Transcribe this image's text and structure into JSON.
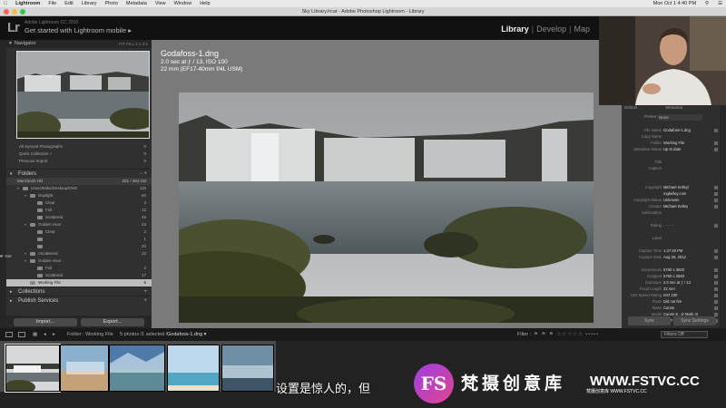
{
  "menubar": {
    "items": [
      "Lightroom",
      "File",
      "Edit",
      "Library",
      "Photo",
      "Metadata",
      "View",
      "Window",
      "Help"
    ],
    "clock": "Mon Oct 1  4:40 PM"
  },
  "window": {
    "title": "Sky Library.lrcat - Adobe Photoshop Lightroom - Library"
  },
  "identity": {
    "small": "Adobe Lightroom CC 2015",
    "big": "Get started with Lightroom mobile  ▸",
    "modules": [
      "Library",
      "Develop",
      "Map"
    ],
    "active_module": "Library"
  },
  "navigator": {
    "title": "Navigator",
    "zoom": "FIT  FILL  1:1  3:1"
  },
  "catalog": {
    "rows": [
      {
        "label": "All Synced Photographs",
        "count": "0"
      },
      {
        "label": "Quick Collection +",
        "count": "0"
      },
      {
        "label": "Previous Import",
        "count": "0"
      }
    ]
  },
  "folders": {
    "title": "Folders",
    "volume": {
      "label": "Macintosh HD",
      "count": "201 / 494 GB"
    },
    "items": [
      {
        "label": "Users/Mike/Desktop/DNG",
        "count": "119",
        "indent": 0,
        "arrow": "▾"
      },
      {
        "label": "Daylight",
        "count": "60",
        "indent": 1,
        "arrow": "▾"
      },
      {
        "label": "Clear",
        "count": "3",
        "indent": 2,
        "arrow": ""
      },
      {
        "label": "Full",
        "count": "12",
        "indent": 2,
        "arrow": ""
      },
      {
        "label": "Scattered",
        "count": "45",
        "indent": 2,
        "arrow": ""
      },
      {
        "label": "Golden Hour",
        "count": "23",
        "indent": 1,
        "arrow": "▾"
      },
      {
        "label": "Clear",
        "count": "2",
        "indent": 2,
        "arrow": ""
      },
      {
        "label": "",
        "count": "1",
        "indent": 2,
        "arrow": ""
      },
      {
        "label": "",
        "count": "20",
        "indent": 2,
        "arrow": ""
      },
      {
        "label": "cScattered",
        "count": "22",
        "indent": 1,
        "arrow": "▾"
      },
      {
        "label": "Golden Hour",
        "count": "",
        "indent": 1,
        "arrow": "▾"
      },
      {
        "label": "Full",
        "count": "2",
        "indent": 2,
        "arrow": ""
      },
      {
        "label": "Scattered",
        "count": "17",
        "indent": 2,
        "arrow": ""
      },
      {
        "label": "Working File",
        "count": "5",
        "indent": 1,
        "arrow": "",
        "selected": true
      }
    ],
    "side_hint": "Get"
  },
  "sections": {
    "collections": "Collections",
    "publish": "Publish Services"
  },
  "buttons": {
    "import": "Import...",
    "export": "Export...",
    "sync": "Sync",
    "sync_settings": "Sync Settings"
  },
  "loupe": {
    "filename": "Godafoss-1.dng",
    "line2": "2.0 sec at ƒ / 13, ISO 100",
    "line3": "22 mm (EF17-40mm f/4L USM)"
  },
  "metadata": {
    "header": "Default",
    "header2": "Metadata",
    "preset_label": "Preset",
    "preset_value": "None",
    "rows": [
      {
        "k": "File Name",
        "v": "Godafoss-1.dng"
      },
      {
        "k": "Copy Name",
        "v": ""
      },
      {
        "k": "Folder",
        "v": "Working File"
      },
      {
        "k": "Metadata Status",
        "v": "Up to date"
      },
      {
        "k": "",
        "v": ""
      },
      {
        "k": "Title",
        "v": ""
      },
      {
        "k": "Caption",
        "v": ""
      },
      {
        "k": "",
        "v": ""
      },
      {
        "k": "",
        "v": ""
      },
      {
        "k": "Copyright",
        "v": "Michael Kelley/"
      },
      {
        "k": "",
        "v": "mgkelley.com"
      },
      {
        "k": "Copyright Status",
        "v": "Unknown"
      },
      {
        "k": "Creator",
        "v": "Michael Kelley"
      },
      {
        "k": "Sublocation",
        "v": ""
      },
      {
        "k": "",
        "v": ""
      },
      {
        "k": "Rating",
        "v": "· · · · ·"
      },
      {
        "k": "",
        "v": ""
      },
      {
        "k": "Label",
        "v": ""
      },
      {
        "k": "",
        "v": ""
      },
      {
        "k": "Capture Time",
        "v": "1:47:20 PM"
      },
      {
        "k": "Capture Date",
        "v": "Aug 26, 2012"
      },
      {
        "k": "",
        "v": ""
      },
      {
        "k": "Dimensions",
        "v": "5760 x 3840"
      },
      {
        "k": "Cropped",
        "v": "5760 x 3840"
      },
      {
        "k": "Exposure",
        "v": "2.0 sec at ƒ / 13"
      },
      {
        "k": "Focal Length",
        "v": "22 mm"
      },
      {
        "k": "ISO Speed Rating",
        "v": "ISO 100"
      },
      {
        "k": "Flash",
        "v": "Did not fire"
      },
      {
        "k": "Make",
        "v": "Canon"
      },
      {
        "k": "Model",
        "v": "Canon E...D Mark III"
      },
      {
        "k": "Lens",
        "v": "EF17-40...f/4L USM"
      }
    ]
  },
  "filmstrip_bar": {
    "folder": "Folder : Working File",
    "count": "5 photos /1 selected /",
    "selected": "Godafoss-1.dng ▾",
    "filter_label": "Filter :",
    "filter_value": "Filters Off"
  },
  "overlay": {
    "caption": "设置是惊人的，但",
    "wm_logo": "FS",
    "wm_name": "梵摄创意库",
    "wm_url": "WWW.FSTVC.CC",
    "wm_small": "梵摄创意库 WWW.FSTVC.CC"
  }
}
